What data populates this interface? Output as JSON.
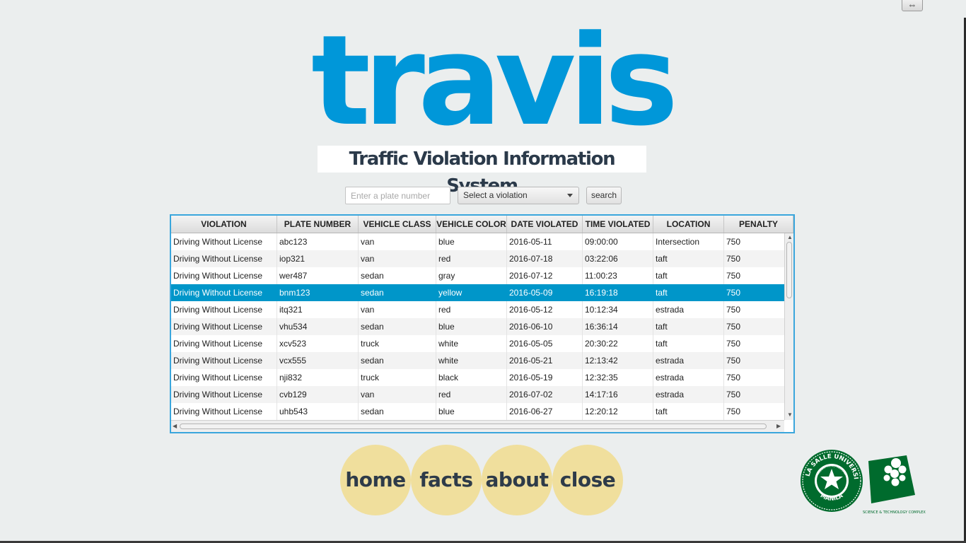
{
  "app": {
    "logo_text": "travis",
    "subtitle": "Traffic Violation Information System"
  },
  "search": {
    "plate_placeholder": "Enter a plate number",
    "violation_select": "Select a violation",
    "search_label": "search"
  },
  "table": {
    "columns": [
      "VIOLATION",
      "PLATE NUMBER",
      "VEHICLE CLASS",
      "VEHICLE COLOR",
      "DATE VIOLATED",
      "TIME VIOLATED",
      "LOCATION",
      "PENALTY"
    ],
    "selected_index": 3,
    "rows": [
      [
        "Driving Without License",
        "abc123",
        "van",
        "blue",
        "2016-05-11",
        "09:00:00",
        "Intersection",
        "750"
      ],
      [
        "Driving Without License",
        "iop321",
        "van",
        "red",
        "2016-07-18",
        "03:22:06",
        "taft",
        "750"
      ],
      [
        "Driving Without License",
        "wer487",
        "sedan",
        "gray",
        "2016-07-12",
        "11:00:23",
        "taft",
        "750"
      ],
      [
        "Driving Without License",
        "bnm123",
        "sedan",
        "yellow",
        "2016-05-09",
        "16:19:18",
        "taft",
        "750"
      ],
      [
        "Driving Without License",
        "itq321",
        "van",
        "red",
        "2016-05-12",
        "10:12:34",
        "estrada",
        "750"
      ],
      [
        "Driving Without License",
        "vhu534",
        "sedan",
        "blue",
        "2016-06-10",
        "16:36:14",
        "taft",
        "750"
      ],
      [
        "Driving Without License",
        "xcv523",
        "truck",
        "white",
        "2016-05-05",
        "20:30:22",
        "taft",
        "750"
      ],
      [
        "Driving Without License",
        "vcx555",
        "sedan",
        "white",
        "2016-05-21",
        "12:13:42",
        "estrada",
        "750"
      ],
      [
        "Driving Without License",
        "nji832",
        "truck",
        "black",
        "2016-05-19",
        "12:32:35",
        "estrada",
        "750"
      ],
      [
        "Driving Without License",
        "cvb129",
        "van",
        "red",
        "2016-07-02",
        "14:17:16",
        "estrada",
        "750"
      ],
      [
        "Driving Without License",
        "uhb543",
        "sedan",
        "blue",
        "2016-06-27",
        "12:20:12",
        "taft",
        "750"
      ]
    ]
  },
  "nav": {
    "home": "home",
    "facts": "facts",
    "about": "about",
    "close": "close"
  },
  "logos": {
    "seal_top": "DE LA SALLE UNIVERSITY",
    "seal_bottom": "MANILA",
    "seal_inner": "RELIGIO MORES CULTURA",
    "stc_caption": "SCIENCE & TECHNOLOGY COMPLEX"
  },
  "window": {
    "corner_icon": "⇔"
  },
  "colors": {
    "brand": "#0097d9",
    "table_border": "#3aa6dc",
    "row_selected": "#0096c9",
    "nav_button": "#f0df9d",
    "dlsu_green": "#006b2d"
  }
}
